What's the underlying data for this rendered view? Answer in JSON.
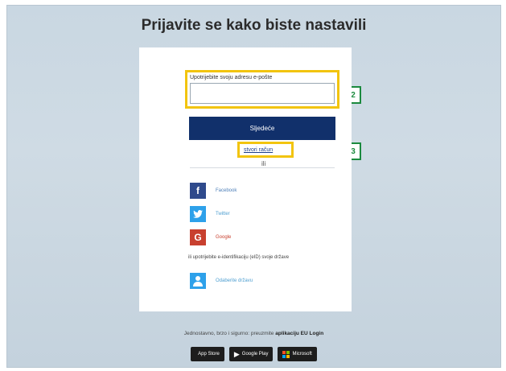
{
  "page": {
    "title": "Prijavite se kako biste nastavili"
  },
  "login": {
    "email_label": "Upotrijebite svoju adresu e-pošte",
    "email_value": "",
    "next_label": "Sljedeće",
    "create_account_label": "stvori račun",
    "or_text": "ili"
  },
  "social": {
    "facebook": {
      "label": "Facebook",
      "icon": "facebook-icon",
      "color": "#2f4a8c"
    },
    "twitter": {
      "label": "Twitter",
      "icon": "twitter-icon",
      "color": "#2ea1ea"
    },
    "google": {
      "label": "Google",
      "icon": "google-icon",
      "color": "#c8402f"
    },
    "eid_text": "ili upotrijebite e-identifikaciju (eID) svoje države",
    "eid": {
      "label": "Odaberite državu",
      "icon": "person-icon",
      "color": "#2ea1ea"
    }
  },
  "annotations": {
    "step_email": "2",
    "step_create": "3",
    "arrow_color": "#c0272d",
    "box_color": "#f2c40f",
    "number_color": "#1b8a3e"
  },
  "footer": {
    "text_prefix": "Jednostavno, brzo i sigurno: preuzmite",
    "text_bold": "aplikaciju EU Login",
    "badges": {
      "app_store": "App Store",
      "google_play": "Google Play",
      "microsoft": "Microsoft"
    }
  }
}
